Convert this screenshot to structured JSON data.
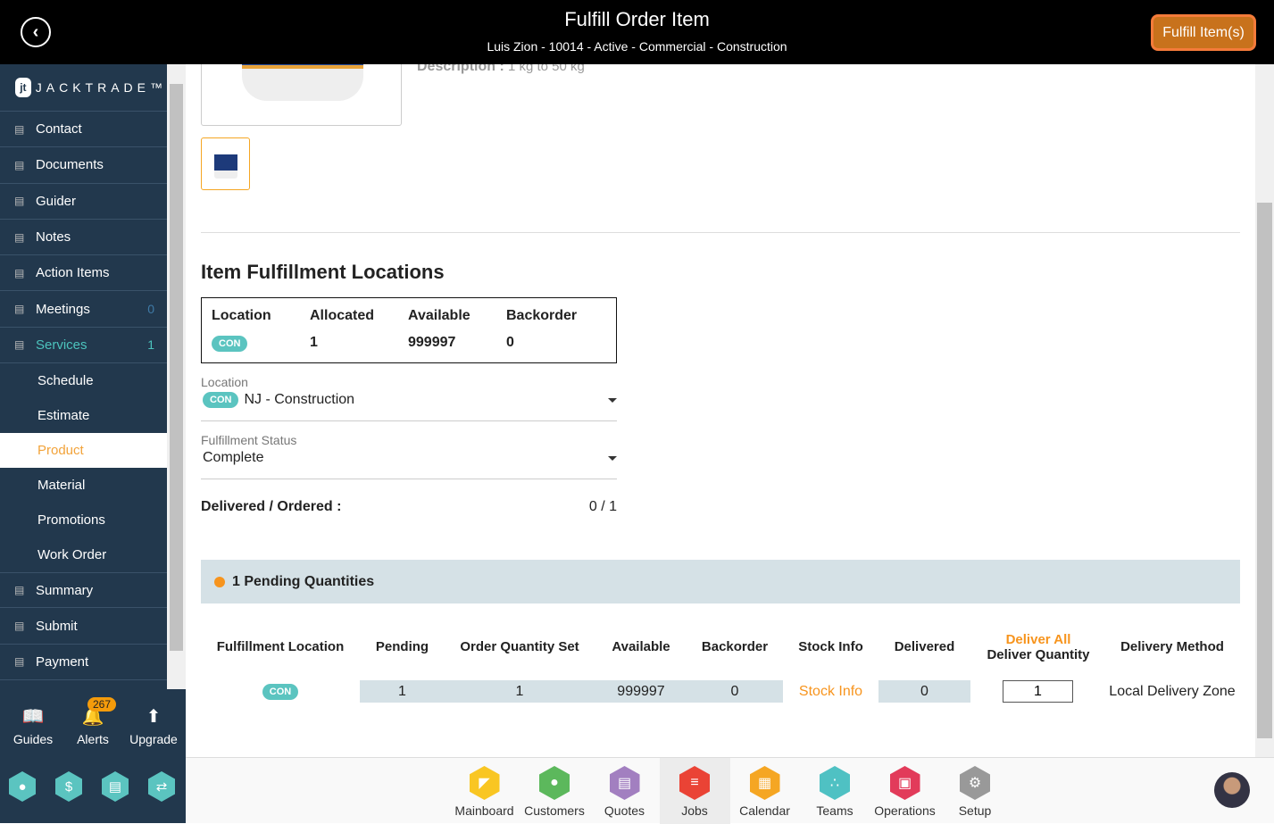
{
  "header": {
    "title": "Fulfill Order Item",
    "subtitle": "Luis Zion - 10014 - Active - Commercial - Construction",
    "fulfill_button": "Fulfill Item(s)"
  },
  "logo": "JACKTRADE™",
  "sidebar": {
    "items": [
      {
        "label": "Contact",
        "icon": "contact-book-icon"
      },
      {
        "label": "Documents",
        "icon": "documents-icon"
      },
      {
        "label": "Guider",
        "icon": "signpost-icon"
      },
      {
        "label": "Notes",
        "icon": "signpost-icon"
      },
      {
        "label": "Action Items",
        "icon": "clipboard-icon"
      },
      {
        "label": "Meetings",
        "icon": "meetings-icon",
        "count": "0"
      },
      {
        "label": "Services",
        "icon": "services-icon",
        "count": "1",
        "active": true
      }
    ],
    "subitems": [
      "Schedule",
      "Estimate",
      "Product",
      "Material",
      "Promotions",
      "Work Order"
    ],
    "selected_subitem": "Product",
    "items2": [
      {
        "label": "Summary",
        "icon": "summary-icon"
      },
      {
        "label": "Submit",
        "icon": "submit-icon"
      },
      {
        "label": "Payment",
        "icon": "payment-icon"
      }
    ]
  },
  "bottom": {
    "guides": "Guides",
    "alerts": "Alerts",
    "alerts_count": "267",
    "upgrade": "Upgrade"
  },
  "product": {
    "description_label": "Description :",
    "description": "1 kg to 50 kg"
  },
  "fulfillment": {
    "title": "Item Fulfillment Locations",
    "table": {
      "headers": [
        "Location",
        "Allocated",
        "Available",
        "Backorder"
      ],
      "row": {
        "location": "CON",
        "allocated": "1",
        "available": "999997",
        "backorder": "0"
      }
    },
    "location_label": "Location",
    "location_tag": "CON",
    "location_value": "NJ - Construction",
    "status_label": "Fulfillment Status",
    "status_value": "Complete",
    "delivered_label": "Delivered / Ordered :",
    "delivered_value": "0 / 1"
  },
  "pending": {
    "title": "1 Pending Quantities",
    "headers": [
      "Fulfillment Location",
      "Pending",
      "Order Quantity Set",
      "Available",
      "Backorder",
      "Stock Info",
      "Delivered",
      "Deliver Quantity",
      "Delivery Method"
    ],
    "deliver_all": "Deliver All",
    "row": {
      "location": "CON",
      "pending": "1",
      "order_qty_set": "1",
      "available": "999997",
      "backorder": "0",
      "stock_info": "Stock Info",
      "delivered": "0",
      "deliver_qty": "1",
      "method": "Local Delivery Zone"
    }
  },
  "dock": [
    {
      "label": "Mainboard",
      "color": "#f9c623"
    },
    {
      "label": "Customers",
      "color": "#5cb85c"
    },
    {
      "label": "Quotes",
      "color": "#a27fc0"
    },
    {
      "label": "Jobs",
      "color": "#ea4335"
    },
    {
      "label": "Calendar",
      "color": "#f5a623"
    },
    {
      "label": "Teams",
      "color": "#4fc1c3"
    },
    {
      "label": "Operations",
      "color": "#e23b5a"
    },
    {
      "label": "Setup",
      "color": "#999999"
    }
  ],
  "colors": {
    "sidebar": "#22384d",
    "teal": "#5bc4c0",
    "orange": "#f7941d"
  }
}
